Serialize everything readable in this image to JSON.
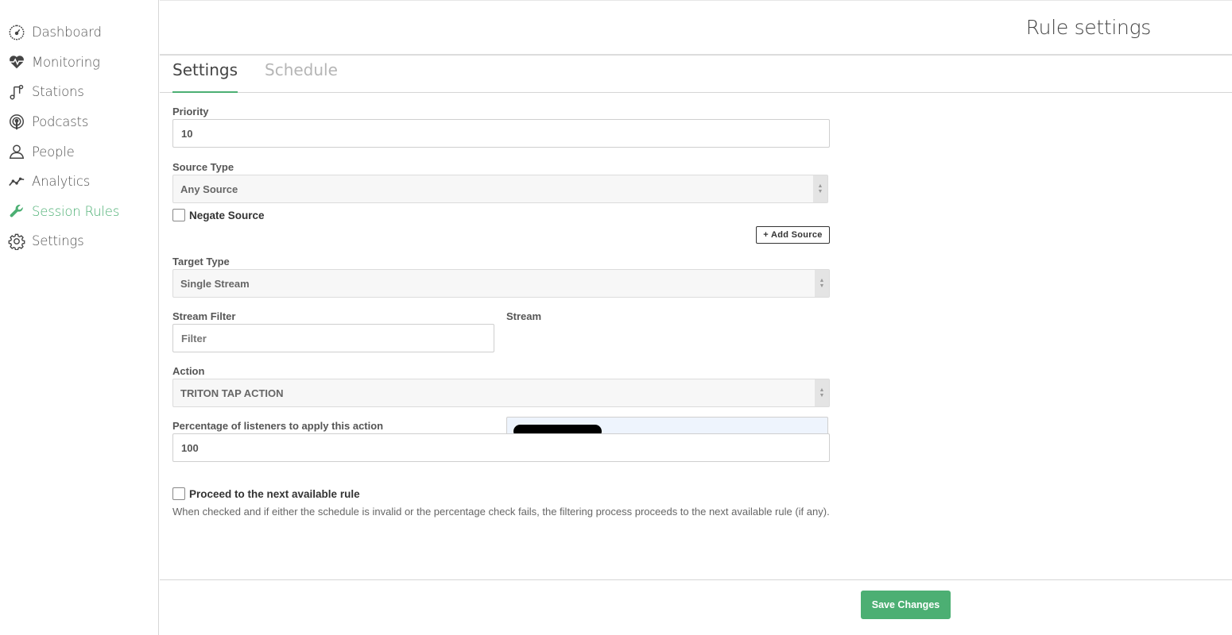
{
  "sidebar": {
    "items": [
      {
        "label": "Dashboard",
        "icon": "dashboard-gauge-icon"
      },
      {
        "label": "Monitoring",
        "icon": "heart-pulse-icon"
      },
      {
        "label": "Stations",
        "icon": "music-note-icon"
      },
      {
        "label": "Podcasts",
        "icon": "podcast-icon"
      },
      {
        "label": "People",
        "icon": "person-icon"
      },
      {
        "label": "Analytics",
        "icon": "trend-line-icon"
      },
      {
        "label": "Session Rules",
        "icon": "wrench-icon",
        "active": true
      },
      {
        "label": "Settings",
        "icon": "gear-icon"
      }
    ]
  },
  "header": {
    "title": "Rule settings"
  },
  "tabs": [
    {
      "label": "Settings",
      "active": true
    },
    {
      "label": "Schedule",
      "active": false
    }
  ],
  "form": {
    "priority": {
      "label": "Priority",
      "value": "10"
    },
    "source_type": {
      "label": "Source Type",
      "value": "Any Source"
    },
    "negate_source": {
      "label": "Negate Source",
      "checked": false
    },
    "add_source_label": "+ Add Source",
    "target_type": {
      "label": "Target Type",
      "value": "Single Stream"
    },
    "stream_filter": {
      "label": "Stream Filter",
      "placeholder": "Filter"
    },
    "stream": {
      "label": "Stream"
    },
    "action": {
      "label": "Action",
      "value": "TRITON TAP ACTION"
    },
    "percentage": {
      "label": "Percentage of listeners to apply this action",
      "value": "100"
    },
    "proceed": {
      "label": "Proceed to the next available rule",
      "checked": false,
      "help": "When checked and if either the schedule is invalid or the percentage check fails, the filtering process proceeds to the next available rule (if any)."
    }
  },
  "footer": {
    "save_label": "Save Changes"
  },
  "colors": {
    "accent": "#4caf73",
    "stream_bg": "#eef4fd"
  }
}
